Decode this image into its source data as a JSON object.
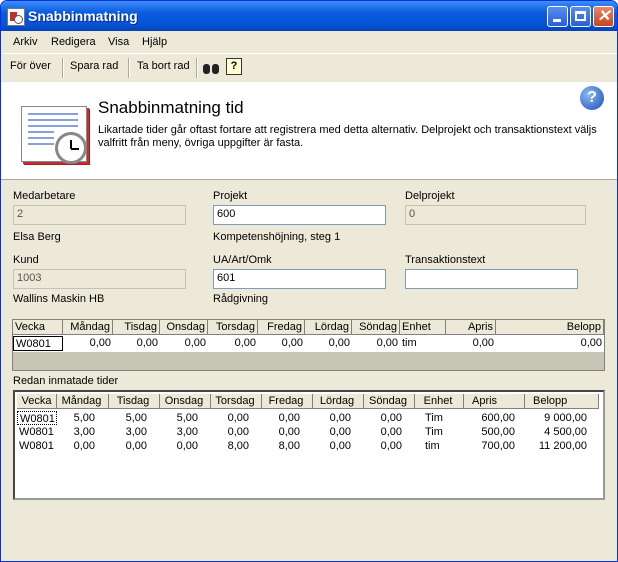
{
  "window": {
    "title": "Snabbinmatning"
  },
  "menu": [
    "Arkiv",
    "Redigera",
    "Visa",
    "Hjälp"
  ],
  "toolbar": {
    "transfer": "För över",
    "save_row": "Spara rad",
    "delete_row": "Ta bort rad",
    "help_glyph": "?"
  },
  "header": {
    "title": "Snabbinmatning tid",
    "description": "Likartade tider går oftast fortare att registrera med detta alternativ. Delprojekt och transaktionstext väljs valfritt från meny, övriga uppgifter är fasta.",
    "help_glyph": "?"
  },
  "form": {
    "employee": {
      "label": "Medarbetare",
      "value": "2",
      "name": "Elsa Berg"
    },
    "project": {
      "label": "Projekt",
      "value": "600",
      "name": "Kompetenshöjning, steg 1"
    },
    "subproject": {
      "label": "Delprojekt",
      "value": "0"
    },
    "customer": {
      "label": "Kund",
      "value": "1003",
      "name": "Wallins Maskin HB"
    },
    "ua": {
      "label": "UA/Art/Omk",
      "value": "601",
      "name": "Rådgivning"
    },
    "transtext": {
      "label": "Transaktionstext",
      "value": ""
    }
  },
  "entry": {
    "columns": [
      "Vecka",
      "Måndag",
      "Tisdag",
      "Onsdag",
      "Torsdag",
      "Fredag",
      "Lördag",
      "Söndag",
      "Enhet",
      "Apris",
      "Belopp"
    ],
    "row": [
      "W0801",
      "0,00",
      "0,00",
      "0,00",
      "0,00",
      "0,00",
      "0,00",
      "0,00",
      "tim",
      "0,00",
      "0,00"
    ]
  },
  "history": {
    "label": "Redan inmatade tider",
    "columns": [
      "Vecka",
      "Måndag",
      "Tisdag",
      "Onsdag",
      "Torsdag",
      "Fredag",
      "Lördag",
      "Söndag",
      "Enhet",
      "Apris",
      "Belopp"
    ],
    "rows": [
      [
        "W0801",
        "5,00",
        "5,00",
        "5,00",
        "0,00",
        "0,00",
        "0,00",
        "0,00",
        "Tim",
        "600,00",
        "9 000,00"
      ],
      [
        "W0801",
        "3,00",
        "3,00",
        "3,00",
        "0,00",
        "0,00",
        "0,00",
        "0,00",
        "Tim",
        "500,00",
        "4 500,00"
      ],
      [
        "W0801",
        "0,00",
        "0,00",
        "0,00",
        "8,00",
        "8,00",
        "0,00",
        "0,00",
        "tim",
        "700,00",
        "11 200,00"
      ]
    ]
  },
  "colors": {
    "titlebar": "#0553d8",
    "face": "#ece9d8",
    "accent": "#c03030"
  },
  "icons": [
    "app-icon",
    "minimize-icon",
    "maximize-icon",
    "close-icon",
    "binoculars-icon",
    "help-icon",
    "book-clock-icon"
  ]
}
